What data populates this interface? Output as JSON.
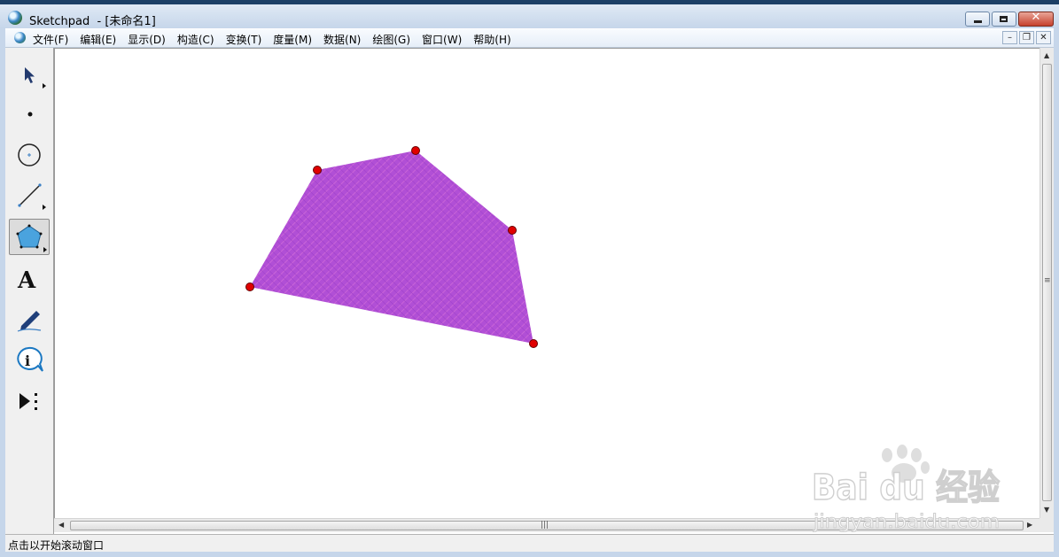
{
  "window": {
    "title": "Sketchpad  - [未命名1]"
  },
  "menu": {
    "items": [
      "文件(F)",
      "编辑(E)",
      "显示(D)",
      "构造(C)",
      "变换(T)",
      "度量(M)",
      "数据(N)",
      "绘图(G)",
      "窗口(W)",
      "帮助(H)"
    ]
  },
  "toolbox": {
    "tools": [
      "arrow-icon",
      "point-icon",
      "compass-icon",
      "straightedge-icon",
      "polygon-icon",
      "text-icon",
      "marker-icon",
      "info-icon",
      "custom-tool-icon"
    ],
    "selected": "polygon-icon"
  },
  "sketch": {
    "polygon_fill": "#b14fd6",
    "hatch_color": "#d06ad8",
    "point_color": "#e00000",
    "vertex_count": 5
  },
  "status": {
    "text": "点击以开始滚动窗口"
  },
  "watermark": {
    "brand": "Bai du 经验",
    "url": "jingyan.baidu.com"
  }
}
